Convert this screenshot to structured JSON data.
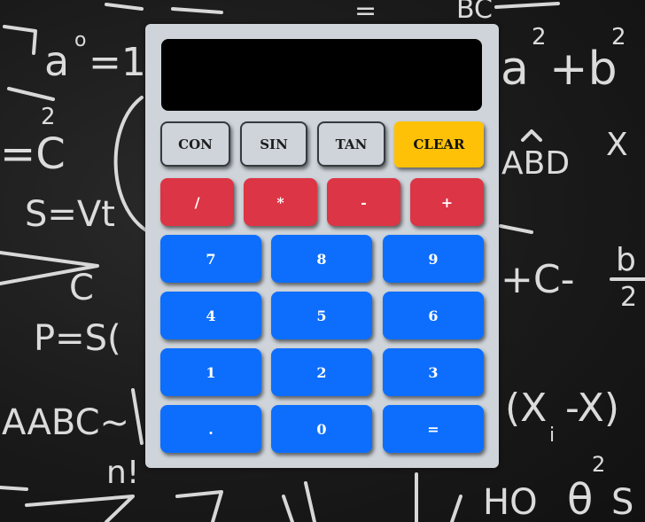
{
  "display": {
    "value": ""
  },
  "buttons": {
    "con": "CON",
    "sin": "SIN",
    "tan": "TAN",
    "clear": "CLEAR",
    "divide": "/",
    "multiply": "*",
    "subtract": "-",
    "add": "+",
    "seven": "7",
    "eight": "8",
    "nine": "9",
    "four": "4",
    "five": "5",
    "six": "6",
    "one": "1",
    "two": "2",
    "three": "3",
    "dot": ".",
    "zero": "0",
    "equals": "="
  },
  "colors": {
    "panel": "#ced4da",
    "display": "#000000",
    "function_key": "#ced4da",
    "clear_key": "#ffc107",
    "operator_key": "#dc3545",
    "number_key": "#0d6efd"
  }
}
